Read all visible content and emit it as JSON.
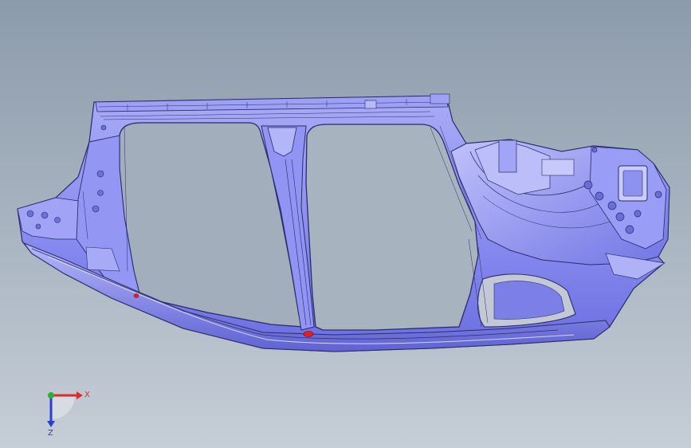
{
  "viewport": {
    "background_top": "#8c9bab",
    "background_bottom": "#c6ced7"
  },
  "model": {
    "body_color": "#8c8ff0",
    "edge_color": "#2a2c6a",
    "highlight_color": "#e02020"
  },
  "triad": {
    "x_label": "X",
    "z_label": "Z",
    "x_color": "#e02a2a",
    "y_color": "#2fae2f",
    "z_color": "#2a3fd0"
  }
}
